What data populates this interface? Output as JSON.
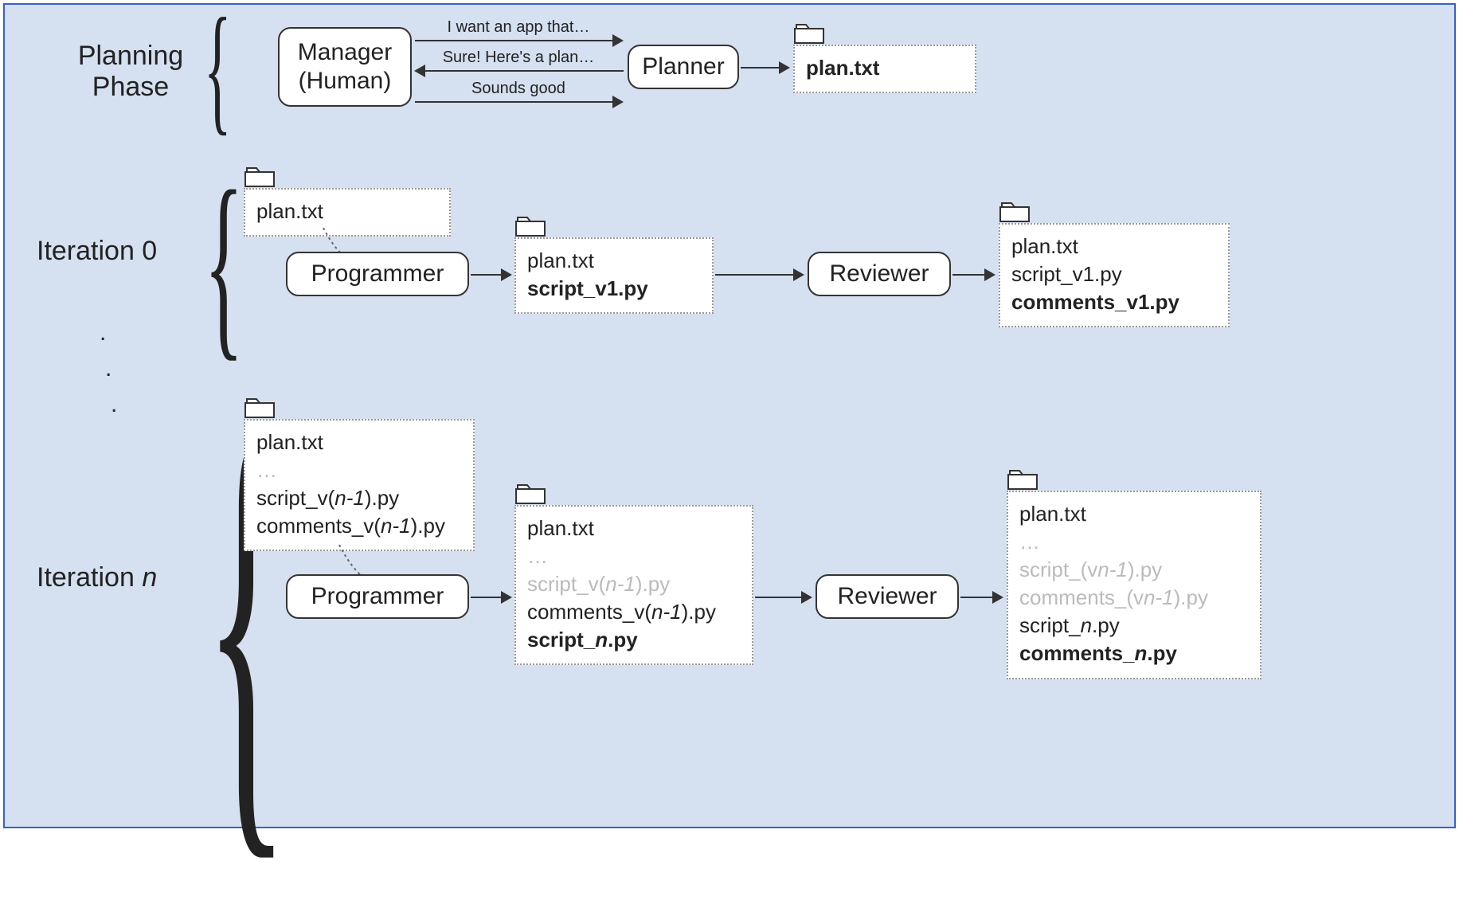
{
  "labels": {
    "planning_phase_l1": "Planning",
    "planning_phase_l2": "Phase",
    "iteration0": "Iteration 0",
    "iteration_n_prefix": "Iteration ",
    "iteration_n_var": "n"
  },
  "nodes": {
    "manager_l1": "Manager",
    "manager_l2": "(Human)",
    "planner": "Planner",
    "programmer": "Programmer",
    "reviewer": "Reviewer"
  },
  "messages": {
    "m1": "I want an app that…",
    "m2": "Sure! Here's a plan…",
    "m3": "Sounds good"
  },
  "files": {
    "plan_txt": "plan.txt",
    "script_v1": "script_v1.py",
    "comments_v1": "comments_v1.py",
    "ellipsis": "…",
    "script_vnm1_pre": "script_v(",
    "script_vnm1_var": "n-1",
    "script_vnm1_post": ").py",
    "comments_vnm1_pre": "comments_v(",
    "comments_vnm1_var": "n-1",
    "comments_vnm1_post": ").py",
    "script_paren_vnm1_pre": "script_(v",
    "script_paren_vnm1_post": ").py",
    "comments_paren_vnm1_pre": "comments_(v",
    "comments_paren_vnm1_post": ").py",
    "script_n_pre": "script_",
    "script_n_var": "n",
    "script_n_post": ".py",
    "comments_n_pre": "comments_",
    "comments_n_var": "n",
    "comments_n_post": ".py"
  }
}
